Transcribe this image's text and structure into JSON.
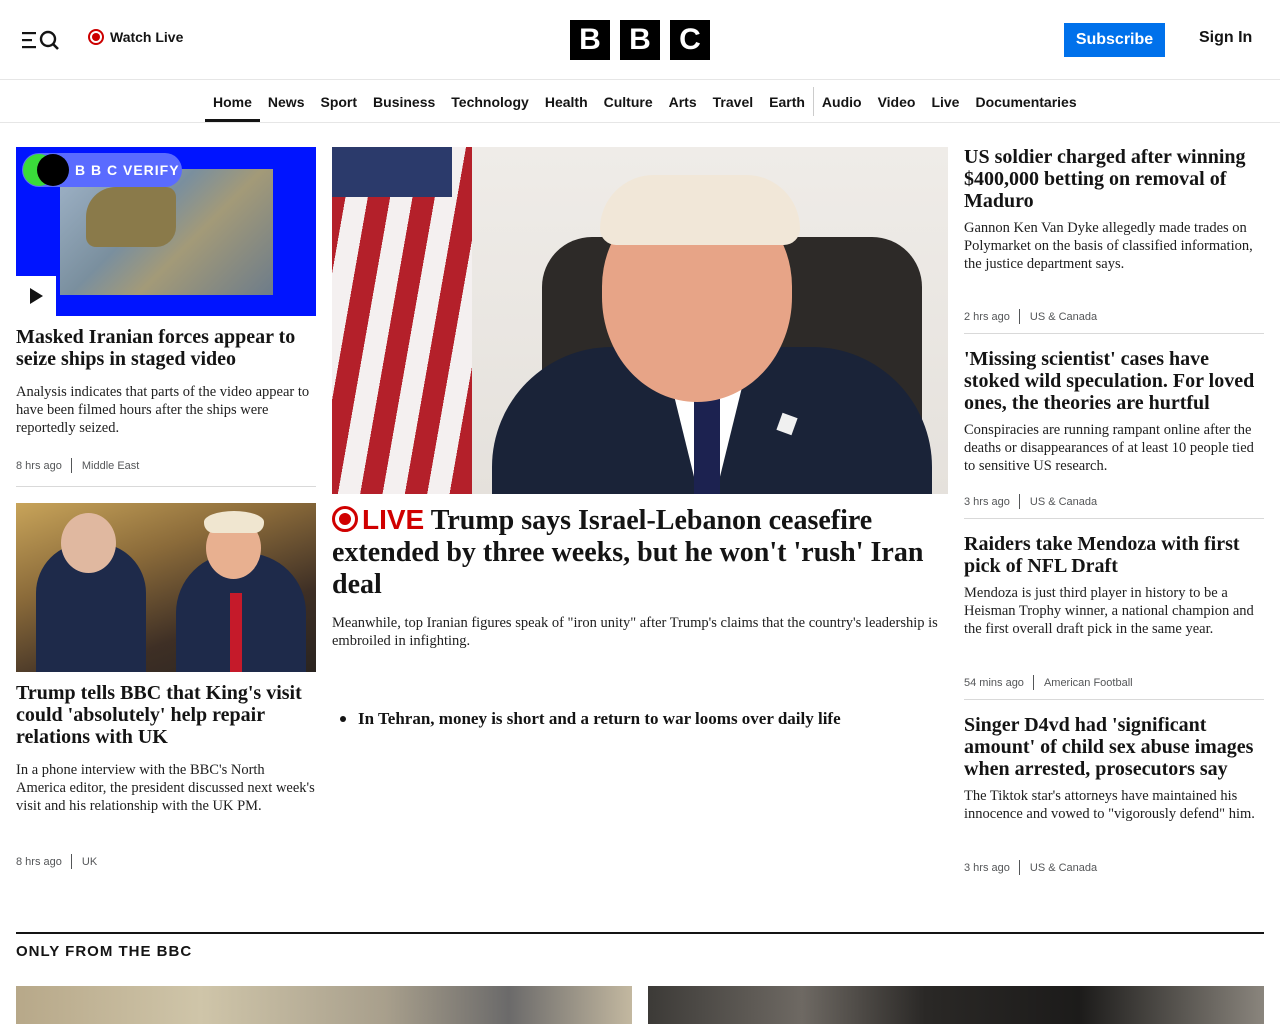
{
  "header": {
    "watch_live": "Watch Live",
    "logo_letters": [
      "B",
      "B",
      "C"
    ],
    "subscribe": "Subscribe",
    "sign_in": "Sign In"
  },
  "nav": {
    "items": [
      "Home",
      "News",
      "Sport",
      "Business",
      "Technology",
      "Health",
      "Culture",
      "Arts",
      "Travel",
      "Earth",
      "Audio",
      "Video",
      "Live",
      "Documentaries"
    ],
    "active": "Home"
  },
  "left": {
    "story1": {
      "badge": "VERIFY",
      "title": "Masked Iranian forces appear to seize ships in staged video",
      "desc": "Analysis indicates that parts of the video appear to have been filmed hours after the ships were reportedly seized.",
      "time": "8 hrs ago",
      "tag": "Middle East"
    },
    "story2": {
      "title": "Trump tells BBC that King's visit could 'absolutely' help repair relations with UK",
      "desc": "In a phone interview with the BBC's North America editor, the president discussed next week's visit and his relationship with the UK PM.",
      "time": "8 hrs ago",
      "tag": "UK"
    }
  },
  "center": {
    "live_label": "LIVE",
    "title": "Trump says Israel-Lebanon ceasefire extended by three weeks, but he won't 'rush' Iran deal",
    "desc": "Meanwhile, top Iranian figures speak of \"iron unity\" after Trump's claims that the country's leadership is embroiled in infighting.",
    "bullet": "In Tehran, money is short and a return to war looms over daily life"
  },
  "right": [
    {
      "title": "US soldier charged after winning $400,000 betting on removal of Maduro",
      "desc": "Gannon Ken Van Dyke allegedly made trades on Polymarket on the basis of classified information, the justice department says.",
      "time": "2 hrs ago",
      "tag": "US & Canada"
    },
    {
      "title": "'Missing scientist' cases have stoked wild speculation. For loved ones, the theories are hurtful",
      "desc": "Conspiracies are running rampant online after the deaths or disappearances of at least 10 people tied to sensitive US research.",
      "time": "3 hrs ago",
      "tag": "US & Canada"
    },
    {
      "title": "Raiders take Mendoza with first pick of NFL Draft",
      "desc": "Mendoza is just third player in history to be a Heisman Trophy winner, a national champion and the first overall draft pick in the same year.",
      "time": "54 mins ago",
      "tag": "American Football"
    },
    {
      "title": "Singer D4vd had 'significant amount' of child sex abuse images when arrested, prosecutors say",
      "desc": "The Tiktok star's attorneys have maintained his innocence and vowed to \"vigorously defend\" him.",
      "time": "3 hrs ago",
      "tag": "US & Canada"
    }
  ],
  "section": {
    "title": "ONLY FROM THE BBC"
  },
  "colors": {
    "subscribe": "#0071eb",
    "live": "#d00000",
    "verify_bg": "#0014ff"
  }
}
